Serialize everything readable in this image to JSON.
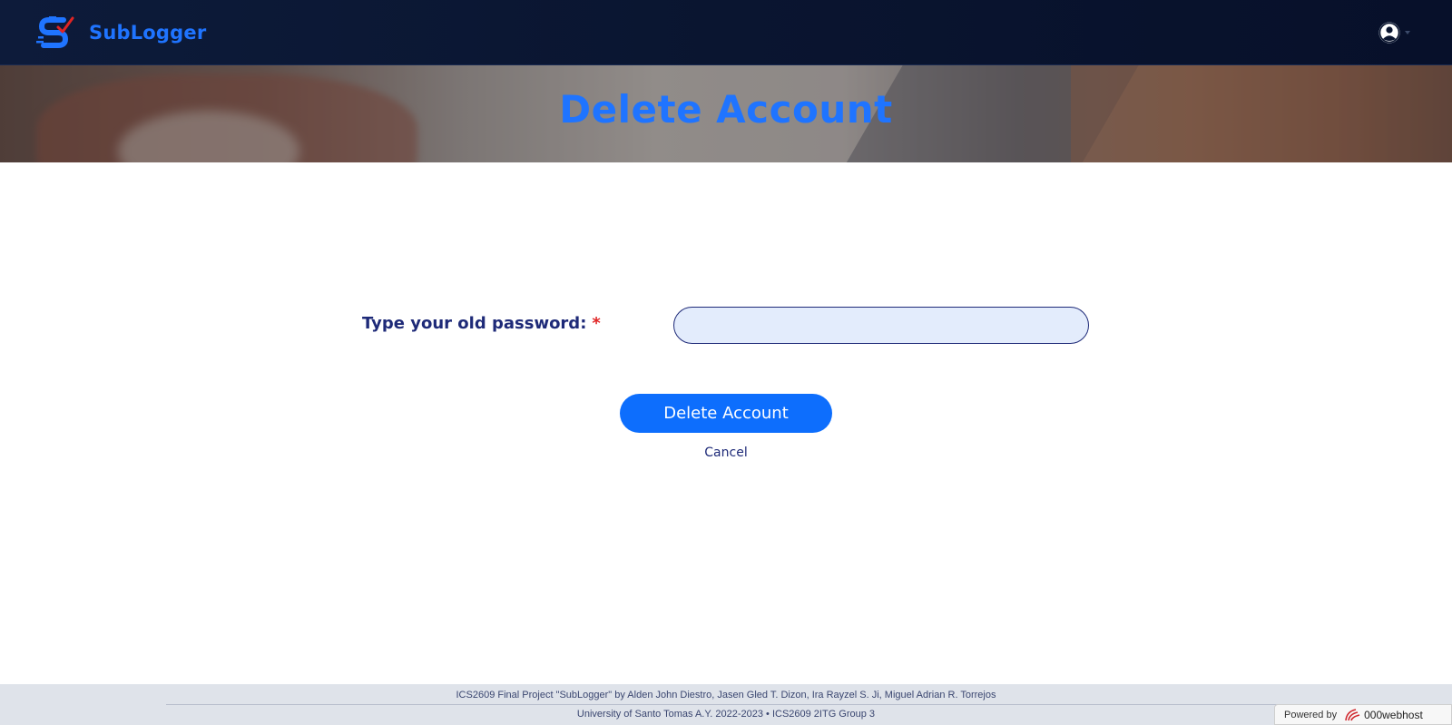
{
  "navbar": {
    "brand_name": "SubLogger",
    "logo_icon": "sublogger-logo",
    "user_icon": "user-circle-icon"
  },
  "hero": {
    "title": "Delete Account"
  },
  "form": {
    "password_label": "Type your old password:",
    "required_mark": "*",
    "password_value": "",
    "delete_button_label": "Delete Account",
    "cancel_label": "Cancel"
  },
  "footer": {
    "line1": "ICS2609 Final Project \"SubLogger\" by Alden John Diestro, Jasen Gled T. Dizon, Ira Rayzel S. Ji, Miguel Adrian R. Torrejos",
    "line2": "University of Santo Tomas A.Y. 2022-2023 • ICS2609 2ITG Group 3"
  },
  "powered_by": {
    "label": "Powered by",
    "host_name": "000webhost"
  },
  "colors": {
    "brand_blue": "#1f74ff",
    "navbar_bg": "#0a1530",
    "button_blue": "#0d6efd",
    "label_navy": "#1e2a78",
    "required_red": "#e02424",
    "input_bg": "#e3ecfc"
  }
}
